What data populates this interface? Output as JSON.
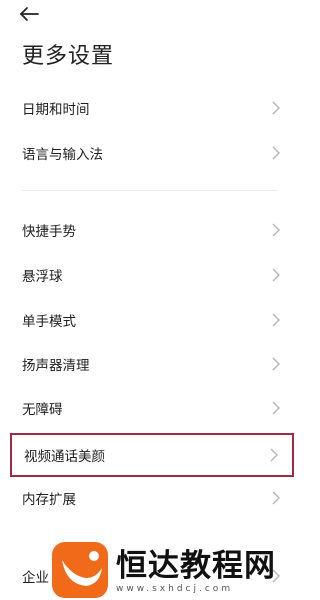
{
  "header": {
    "back_icon": "arrow-left-icon",
    "title": "更多设置"
  },
  "settings": {
    "items": [
      {
        "label": "日期和时间"
      },
      {
        "label": "语言与输入法"
      },
      {
        "label": "快捷手势"
      },
      {
        "label": "悬浮球"
      },
      {
        "label": "单手模式"
      },
      {
        "label": "扬声器清理"
      },
      {
        "label": "无障碍"
      },
      {
        "label": "视频通话美颜"
      },
      {
        "label": "内存扩展"
      },
      {
        "label": "企业"
      }
    ],
    "chevron_icon": "chevron-right-icon",
    "highlight_color": "#9b2c43"
  },
  "watermark": {
    "text": "恒达教程网",
    "url": "www.sxhdcj.com",
    "logo_color": "#f06a1a"
  }
}
